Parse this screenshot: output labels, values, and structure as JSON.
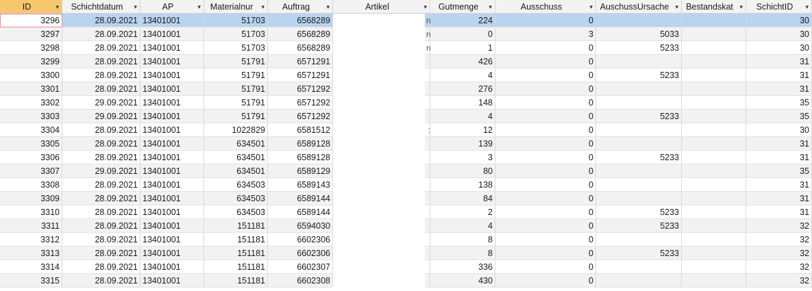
{
  "headers": [
    {
      "label": "ID",
      "active": true
    },
    {
      "label": "Schichtdatum"
    },
    {
      "label": "AP"
    },
    {
      "label": "Materialnur"
    },
    {
      "label": "Auftrag"
    },
    {
      "label": "Artikel"
    },
    {
      "label": "Gutmenge"
    },
    {
      "label": "Ausschuss"
    },
    {
      "label": "AuschussUrsache"
    },
    {
      "label": "Bestandskat"
    },
    {
      "label": "SchichtID"
    }
  ],
  "dropdown_glyph": "▾",
  "rows": [
    {
      "id": "3296",
      "datum": "28.09.2021",
      "ap": "13401001",
      "material": "51703",
      "auftrag": "6568289",
      "artikel_edge": "n",
      "gut": "224",
      "ausschuss": "0",
      "ursache": "",
      "bestand": "",
      "schicht": "30",
      "selected": true
    },
    {
      "id": "3297",
      "datum": "28.09.2021",
      "ap": "13401001",
      "material": "51703",
      "auftrag": "6568289",
      "artikel_edge": "n",
      "gut": "0",
      "ausschuss": "3",
      "ursache": "5033",
      "bestand": "",
      "schicht": "30"
    },
    {
      "id": "3298",
      "datum": "28.09.2021",
      "ap": "13401001",
      "material": "51703",
      "auftrag": "6568289",
      "artikel_edge": "n",
      "gut": "1",
      "ausschuss": "0",
      "ursache": "5233",
      "bestand": "",
      "schicht": "30"
    },
    {
      "id": "3299",
      "datum": "28.09.2021",
      "ap": "13401001",
      "material": "51791",
      "auftrag": "6571291",
      "artikel_edge": "",
      "gut": "426",
      "ausschuss": "0",
      "ursache": "",
      "bestand": "",
      "schicht": "31"
    },
    {
      "id": "3300",
      "datum": "28.09.2021",
      "ap": "13401001",
      "material": "51791",
      "auftrag": "6571291",
      "artikel_edge": "",
      "gut": "4",
      "ausschuss": "0",
      "ursache": "5233",
      "bestand": "",
      "schicht": "31"
    },
    {
      "id": "3301",
      "datum": "28.09.2021",
      "ap": "13401001",
      "material": "51791",
      "auftrag": "6571292",
      "artikel_edge": "",
      "gut": "276",
      "ausschuss": "0",
      "ursache": "",
      "bestand": "",
      "schicht": "31"
    },
    {
      "id": "3302",
      "datum": "29.09.2021",
      "ap": "13401001",
      "material": "51791",
      "auftrag": "6571292",
      "artikel_edge": "",
      "gut": "148",
      "ausschuss": "0",
      "ursache": "",
      "bestand": "",
      "schicht": "35"
    },
    {
      "id": "3303",
      "datum": "29.09.2021",
      "ap": "13401001",
      "material": "51791",
      "auftrag": "6571292",
      "artikel_edge": "",
      "gut": "4",
      "ausschuss": "0",
      "ursache": "5233",
      "bestand": "",
      "schicht": "35"
    },
    {
      "id": "3304",
      "datum": "28.09.2021",
      "ap": "13401001",
      "material": "1022829",
      "auftrag": "6581512",
      "artikel_edge": ":",
      "gut": "12",
      "ausschuss": "0",
      "ursache": "",
      "bestand": "",
      "schicht": "30"
    },
    {
      "id": "3305",
      "datum": "28.09.2021",
      "ap": "13401001",
      "material": "634501",
      "auftrag": "6589128",
      "artikel_edge": "",
      "gut": "139",
      "ausschuss": "0",
      "ursache": "",
      "bestand": "",
      "schicht": "31"
    },
    {
      "id": "3306",
      "datum": "28.09.2021",
      "ap": "13401001",
      "material": "634501",
      "auftrag": "6589128",
      "artikel_edge": "",
      "gut": "3",
      "ausschuss": "0",
      "ursache": "5233",
      "bestand": "",
      "schicht": "31"
    },
    {
      "id": "3307",
      "datum": "29.09.2021",
      "ap": "13401001",
      "material": "634501",
      "auftrag": "6589129",
      "artikel_edge": "",
      "gut": "80",
      "ausschuss": "0",
      "ursache": "",
      "bestand": "",
      "schicht": "35"
    },
    {
      "id": "3308",
      "datum": "28.09.2021",
      "ap": "13401001",
      "material": "634503",
      "auftrag": "6589143",
      "artikel_edge": "",
      "gut": "138",
      "ausschuss": "0",
      "ursache": "",
      "bestand": "",
      "schicht": "31"
    },
    {
      "id": "3309",
      "datum": "28.09.2021",
      "ap": "13401001",
      "material": "634503",
      "auftrag": "6589144",
      "artikel_edge": "",
      "gut": "84",
      "ausschuss": "0",
      "ursache": "",
      "bestand": "",
      "schicht": "31"
    },
    {
      "id": "3310",
      "datum": "28.09.2021",
      "ap": "13401001",
      "material": "634503",
      "auftrag": "6589144",
      "artikel_edge": "",
      "gut": "2",
      "ausschuss": "0",
      "ursache": "5233",
      "bestand": "",
      "schicht": "31"
    },
    {
      "id": "3311",
      "datum": "28.09.2021",
      "ap": "13401001",
      "material": "151181",
      "auftrag": "6594030",
      "artikel_edge": "",
      "gut": "4",
      "ausschuss": "0",
      "ursache": "5233",
      "bestand": "",
      "schicht": "32"
    },
    {
      "id": "3312",
      "datum": "28.09.2021",
      "ap": "13401001",
      "material": "151181",
      "auftrag": "6602306",
      "artikel_edge": "",
      "gut": "8",
      "ausschuss": "0",
      "ursache": "",
      "bestand": "",
      "schicht": "32"
    },
    {
      "id": "3313",
      "datum": "28.09.2021",
      "ap": "13401001",
      "material": "151181",
      "auftrag": "6602306",
      "artikel_edge": "",
      "gut": "8",
      "ausschuss": "0",
      "ursache": "5233",
      "bestand": "",
      "schicht": "32"
    },
    {
      "id": "3314",
      "datum": "28.09.2021",
      "ap": "13401001",
      "material": "151181",
      "auftrag": "6602307",
      "artikel_edge": "",
      "gut": "336",
      "ausschuss": "0",
      "ursache": "",
      "bestand": "",
      "schicht": "32"
    },
    {
      "id": "3315",
      "datum": "28.09.2021",
      "ap": "13401001",
      "material": "151181",
      "auftrag": "6602308",
      "artikel_edge": "",
      "gut": "430",
      "ausschuss": "0",
      "ursache": "",
      "bestand": "",
      "schicht": "32"
    }
  ]
}
